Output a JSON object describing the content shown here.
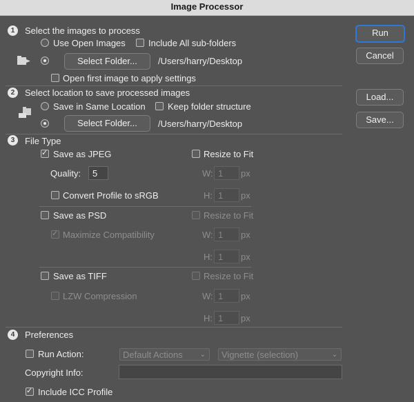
{
  "window": {
    "title": "Image Processor"
  },
  "section1": {
    "number": "1",
    "title": "Select the images to process",
    "use_open_images": "Use Open Images",
    "include_subfolders": "Include All sub-folders",
    "select_folder": "Select Folder...",
    "folder_path": "/Users/harry/Desktop",
    "open_first_image": "Open first image to apply settings"
  },
  "section2": {
    "number": "2",
    "title": "Select location to save processed images",
    "save_same_location": "Save in Same Location",
    "keep_structure": "Keep folder structure",
    "select_folder": "Select Folder...",
    "folder_path": "/Users/harry/Desktop"
  },
  "section3": {
    "number": "3",
    "title": "File Type",
    "jpeg": {
      "save_label": "Save as JPEG",
      "resize_label": "Resize to Fit",
      "quality_label": "Quality:",
      "quality_value": "5",
      "w_label": "W:",
      "h_label": "H:",
      "w_value": "1",
      "h_value": "1",
      "px": "px",
      "convert_label": "Convert Profile to sRGB"
    },
    "psd": {
      "save_label": "Save as PSD",
      "resize_label": "Resize to Fit",
      "max_compat_label": "Maximize Compatibility",
      "w_label": "W:",
      "h_label": "H:",
      "w_value": "1",
      "h_value": "1",
      "px": "px"
    },
    "tiff": {
      "save_label": "Save as TIFF",
      "resize_label": "Resize to Fit",
      "lzw_label": "LZW Compression",
      "w_label": "W:",
      "h_label": "H:",
      "w_value": "1",
      "h_value": "1",
      "px": "px"
    }
  },
  "section4": {
    "number": "4",
    "title": "Preferences",
    "run_action_label": "Run Action:",
    "action_set": "Default Actions",
    "action_name": "Vignette (selection)",
    "copyright_label": "Copyright Info:",
    "copyright_value": "",
    "include_icc": "Include ICC Profile"
  },
  "buttons": {
    "run": "Run",
    "cancel": "Cancel",
    "load": "Load...",
    "save": "Save..."
  },
  "colors": {
    "background": "#535353",
    "primary_border": "#2f78d6",
    "titlebar": "#dcdcdc"
  }
}
